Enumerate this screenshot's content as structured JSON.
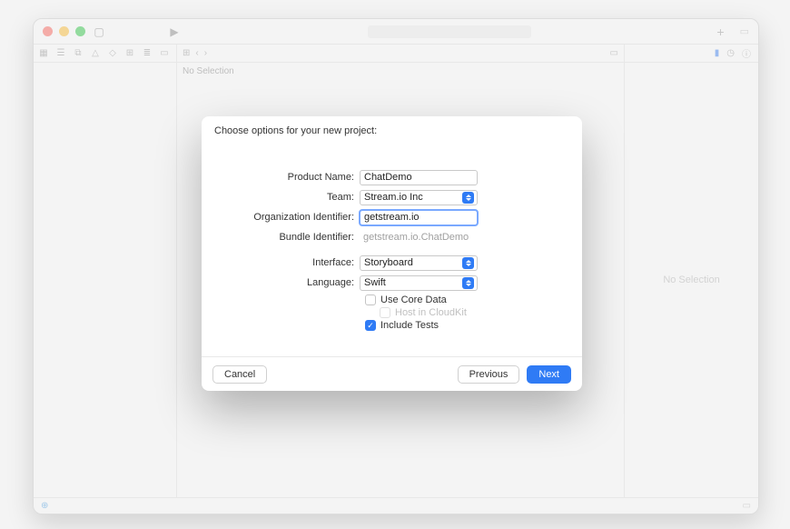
{
  "window": {
    "center_no_selection": "No Selection",
    "right_no_selection": "No Selection"
  },
  "sheet": {
    "title": "Choose options for your new project:",
    "labels": {
      "product_name": "Product Name:",
      "team": "Team:",
      "organization_identifier": "Organization Identifier:",
      "bundle_identifier": "Bundle Identifier:",
      "interface": "Interface:",
      "language": "Language:"
    },
    "values": {
      "product_name": "ChatDemo",
      "team": "Stream.io Inc",
      "organization_identifier": "getstream.io",
      "bundle_identifier": "getstream.io.ChatDemo",
      "interface": "Storyboard",
      "language": "Swift"
    },
    "checkboxes": {
      "use_core_data": {
        "label": "Use Core Data",
        "checked": false,
        "enabled": true
      },
      "host_in_cloudkit": {
        "label": "Host in CloudKit",
        "checked": false,
        "enabled": false
      },
      "include_tests": {
        "label": "Include Tests",
        "checked": true,
        "enabled": true
      }
    },
    "buttons": {
      "cancel": "Cancel",
      "previous": "Previous",
      "next": "Next"
    }
  }
}
